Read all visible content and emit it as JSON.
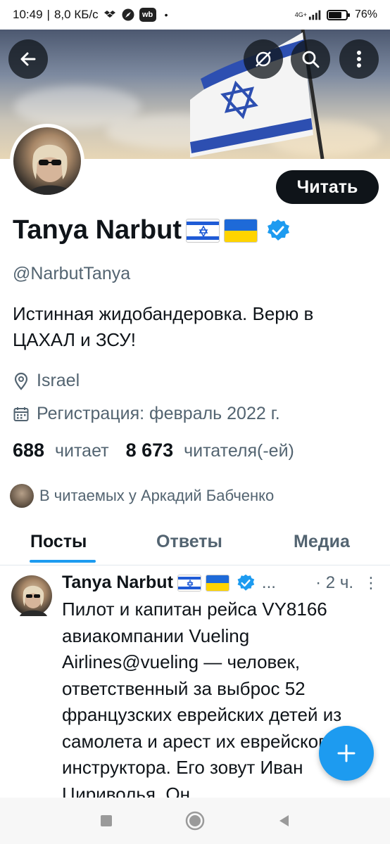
{
  "status_bar": {
    "time": "10:49",
    "speed": "8,0 КБ/с",
    "wb_label": "wb",
    "dot": "•",
    "network": "4G+",
    "battery": "76",
    "battery_fraction": 0.76,
    "icons": [
      "dropbox-icon",
      "compass-icon",
      "wb-icon",
      "signal-icon",
      "battery-icon"
    ]
  },
  "header": {
    "back_icon": "arrow-left-icon",
    "translate_icon": "no-translate-icon",
    "search_icon": "search-icon",
    "more_icon": "more-vertical-icon",
    "banner": "israel-flag-banner"
  },
  "profile": {
    "name": "Tanya Narbut",
    "flags": [
      "israel-flag-icon",
      "ukraine-flag-icon"
    ],
    "verified_icon": "verified-badge-icon",
    "handle": "@NarbutTanya",
    "bio": "Истинная жидобандеровка. Верю в ЦАХАЛ и ЗСУ!",
    "location": "Israel",
    "joined": "Регистрация: февраль 2022 г.",
    "following_count": "688",
    "following_label": "читает",
    "followers_count": "8 673",
    "followers_label": "читателя(-ей)",
    "followed_by": "В читаемых у Аркадий Бабченко",
    "follow_button": "Читать"
  },
  "tabs": [
    {
      "label": "Посты",
      "active": true
    },
    {
      "label": "Ответы",
      "active": false
    },
    {
      "label": "Медиа",
      "active": false
    }
  ],
  "post": {
    "author": "Tanya Narbut",
    "ellipsis": "...",
    "time": "· 2 ч.",
    "more": "⋮",
    "text": "Пилот и капитан рейса VY8166 авиакомпании Vueling Airlines@vueling — человек, ответственный за выброс 52 французских еврейских детей из самолета и арест их еврейского инструктора. Его зовут Иван Цириволья. Он"
  },
  "fab": {
    "icon": "plus-icon"
  },
  "navbar": {
    "icons": [
      "recent-apps-icon",
      "home-icon",
      "back-icon"
    ]
  },
  "colors": {
    "accent": "#1d9bf0",
    "text": "#0f1419",
    "muted": "#536471"
  }
}
